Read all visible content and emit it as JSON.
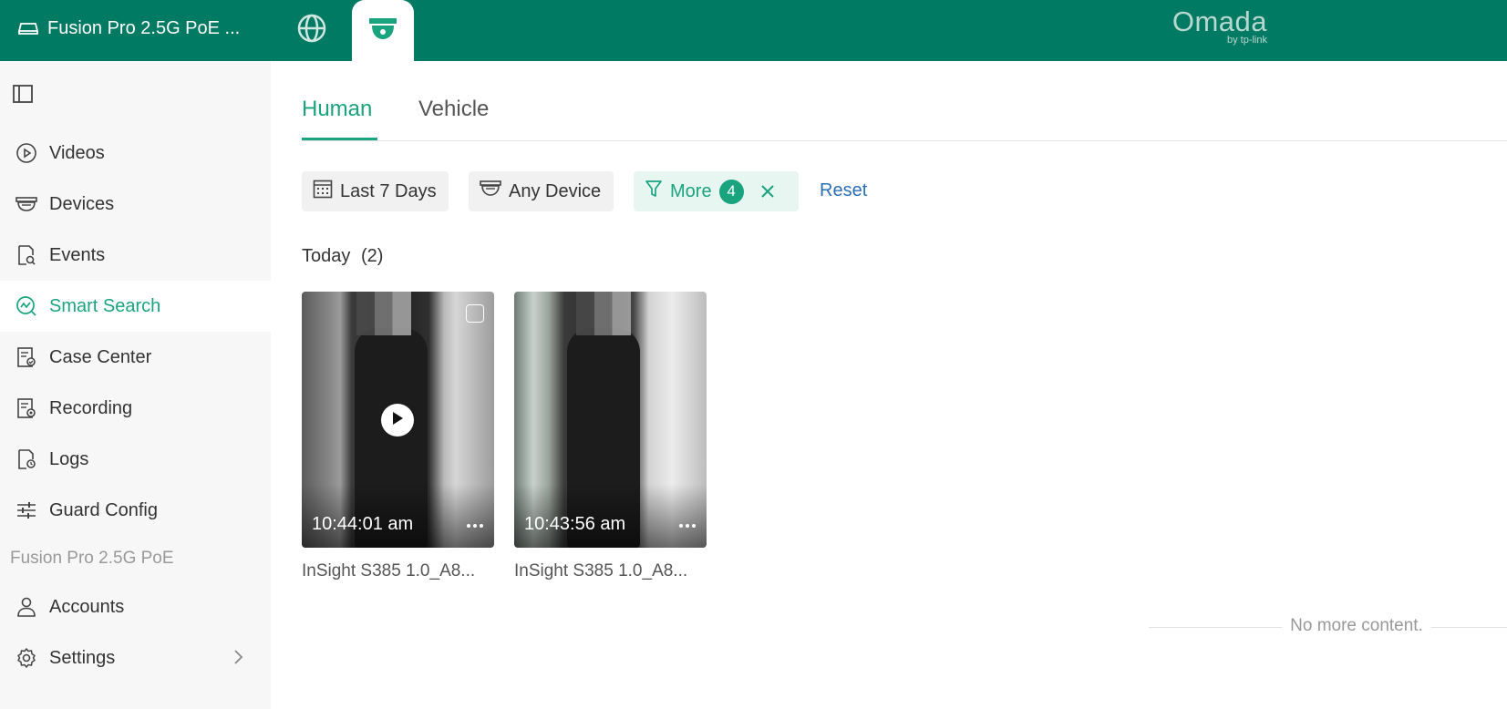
{
  "topbar": {
    "device_name": "Fusion Pro 2.5G PoE ...",
    "logo_text": "Omada",
    "logo_sub": "by tp-link"
  },
  "sidebar": {
    "items": [
      {
        "label": "Videos",
        "icon": "play-circle-icon"
      },
      {
        "label": "Devices",
        "icon": "camera-icon"
      },
      {
        "label": "Events",
        "icon": "event-search-icon"
      },
      {
        "label": "Smart Search",
        "icon": "smart-search-icon",
        "active": true
      },
      {
        "label": "Case Center",
        "icon": "case-icon"
      },
      {
        "label": "Recording",
        "icon": "recording-icon"
      },
      {
        "label": "Logs",
        "icon": "logs-icon"
      },
      {
        "label": "Guard Config",
        "icon": "sliders-icon"
      }
    ],
    "group_label": "Fusion Pro 2.5G PoE",
    "bottom_items": [
      {
        "label": "Accounts",
        "icon": "user-icon"
      },
      {
        "label": "Settings",
        "icon": "gear-icon"
      }
    ]
  },
  "tabs": {
    "human": "Human",
    "vehicle": "Vehicle"
  },
  "filters": {
    "date": "Last 7 Days",
    "device": "Any Device",
    "more": "More",
    "more_count": "4",
    "reset": "Reset"
  },
  "section": {
    "title": "Today",
    "count": "(2)"
  },
  "clips": [
    {
      "time": "10:44:01 am",
      "caption": "InSight S385 1.0_A8..."
    },
    {
      "time": "10:43:56 am",
      "caption": "InSight S385 1.0_A8..."
    }
  ],
  "footer": {
    "no_more": "No more content."
  },
  "colors": {
    "topbar": "#017a64",
    "accent": "#1aa37f",
    "link": "#2b6fb6"
  }
}
